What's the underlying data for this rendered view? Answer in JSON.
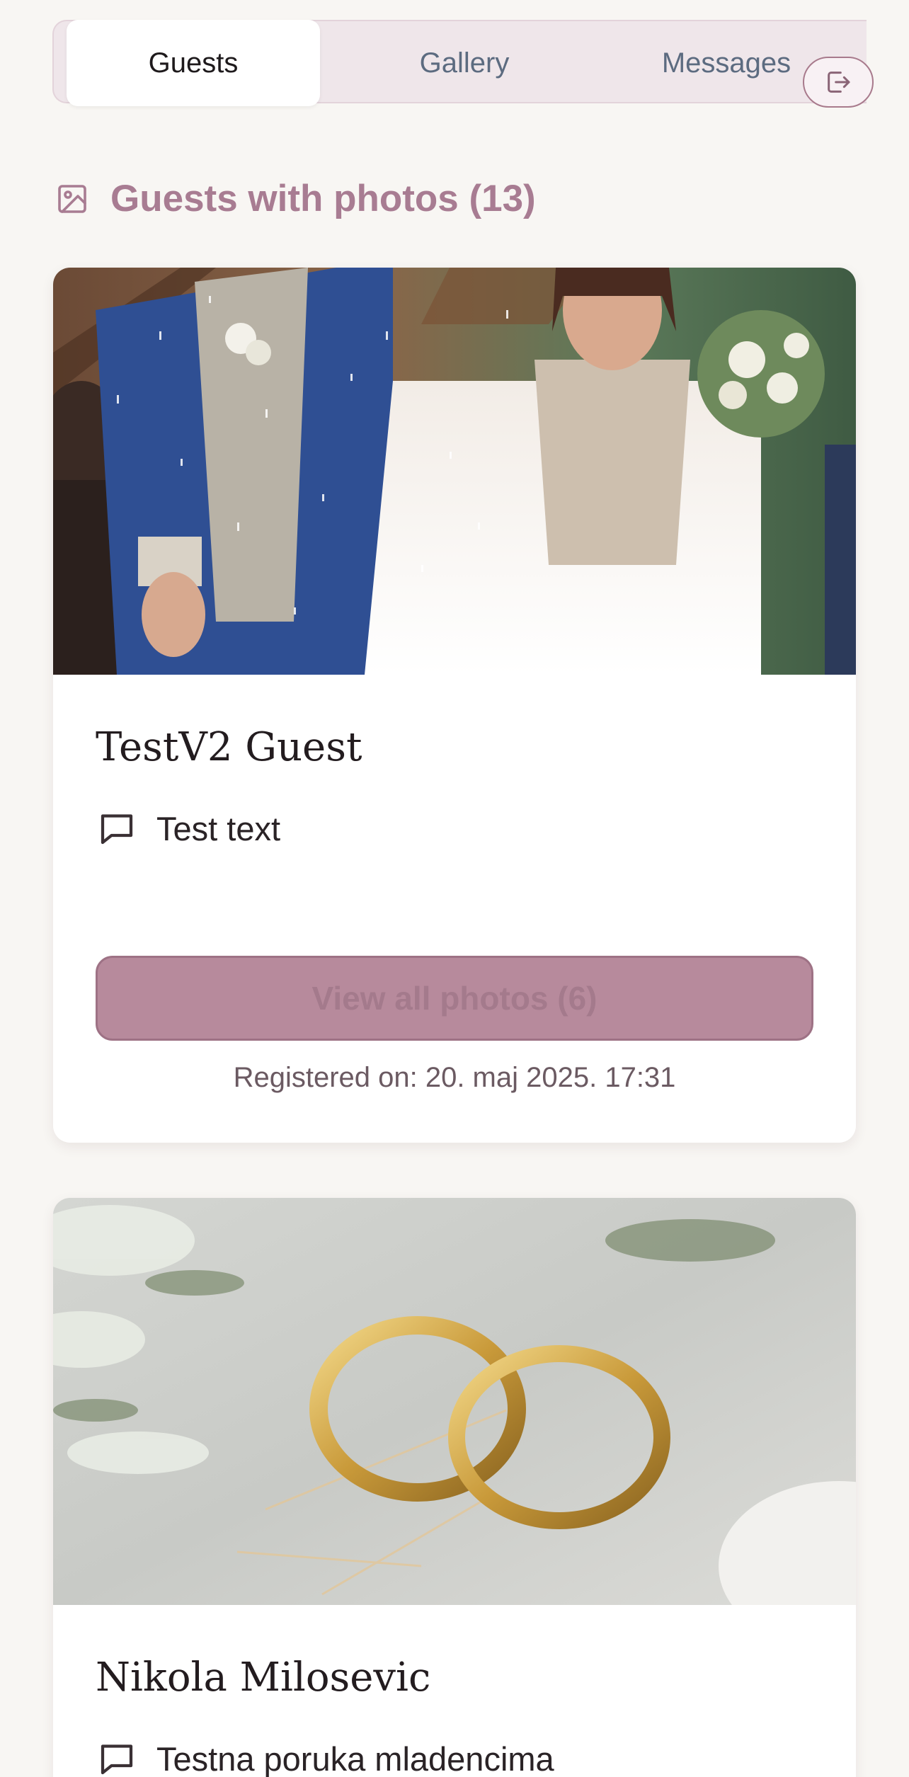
{
  "tabs": {
    "guests": "Guests",
    "gallery": "Gallery",
    "messages": "Messages",
    "active": "Guests"
  },
  "section": {
    "title": "Guests with photos (13)",
    "icon": "image-icon"
  },
  "guests": [
    {
      "name": "TestV2 Guest",
      "message": "Test text",
      "button_label": "View all photos (6)",
      "registered": "Registered on: 20. maj 2025. 17:31"
    },
    {
      "name": "Nikola Milosevic",
      "message": "Testna poruka mladencima"
    }
  ],
  "colors": {
    "accent": "#a87c92",
    "background": "#f8f6f3",
    "tab_bar": "#efe6ea",
    "button": "#b78a9c"
  }
}
